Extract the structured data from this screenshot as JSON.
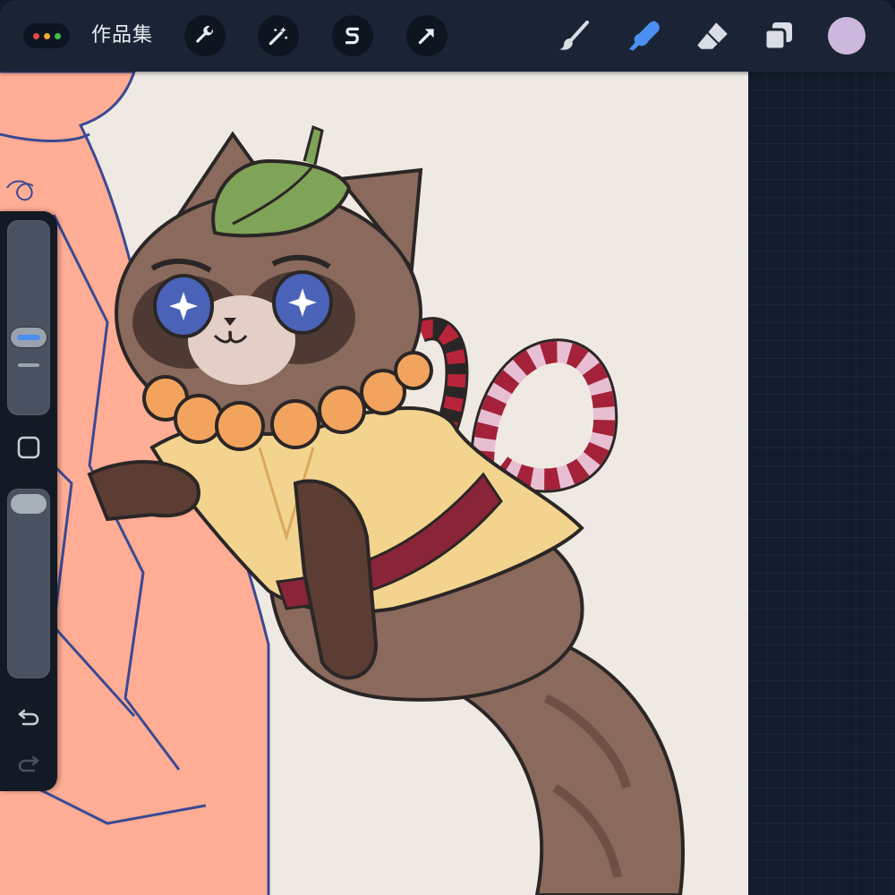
{
  "app": {
    "gallery_label": "作品集"
  },
  "toolbar": {
    "left_tools": [
      {
        "name": "actions",
        "icon": "wrench-icon"
      },
      {
        "name": "adjustments",
        "icon": "magic-wand-icon"
      },
      {
        "name": "selection",
        "icon": "selection-s-icon"
      },
      {
        "name": "transform",
        "icon": "arrow-cursor-icon"
      }
    ],
    "right_tools": [
      {
        "name": "brush",
        "icon": "brush-icon",
        "active": false
      },
      {
        "name": "smudge",
        "icon": "smudge-finger-icon",
        "active": true
      },
      {
        "name": "eraser",
        "icon": "eraser-icon",
        "active": false
      },
      {
        "name": "layers",
        "icon": "layers-icon",
        "active": false
      }
    ],
    "current_color": "#cdb8dd",
    "accent_color": "#4b8ff0"
  },
  "sidebar": {
    "brush_size_level": 0.55,
    "opacity_level": 1.0,
    "modify_button_icon": "square-icon",
    "undo_icon": "undo-arrow-icon",
    "redo_icon": "redo-arrow-icon"
  }
}
